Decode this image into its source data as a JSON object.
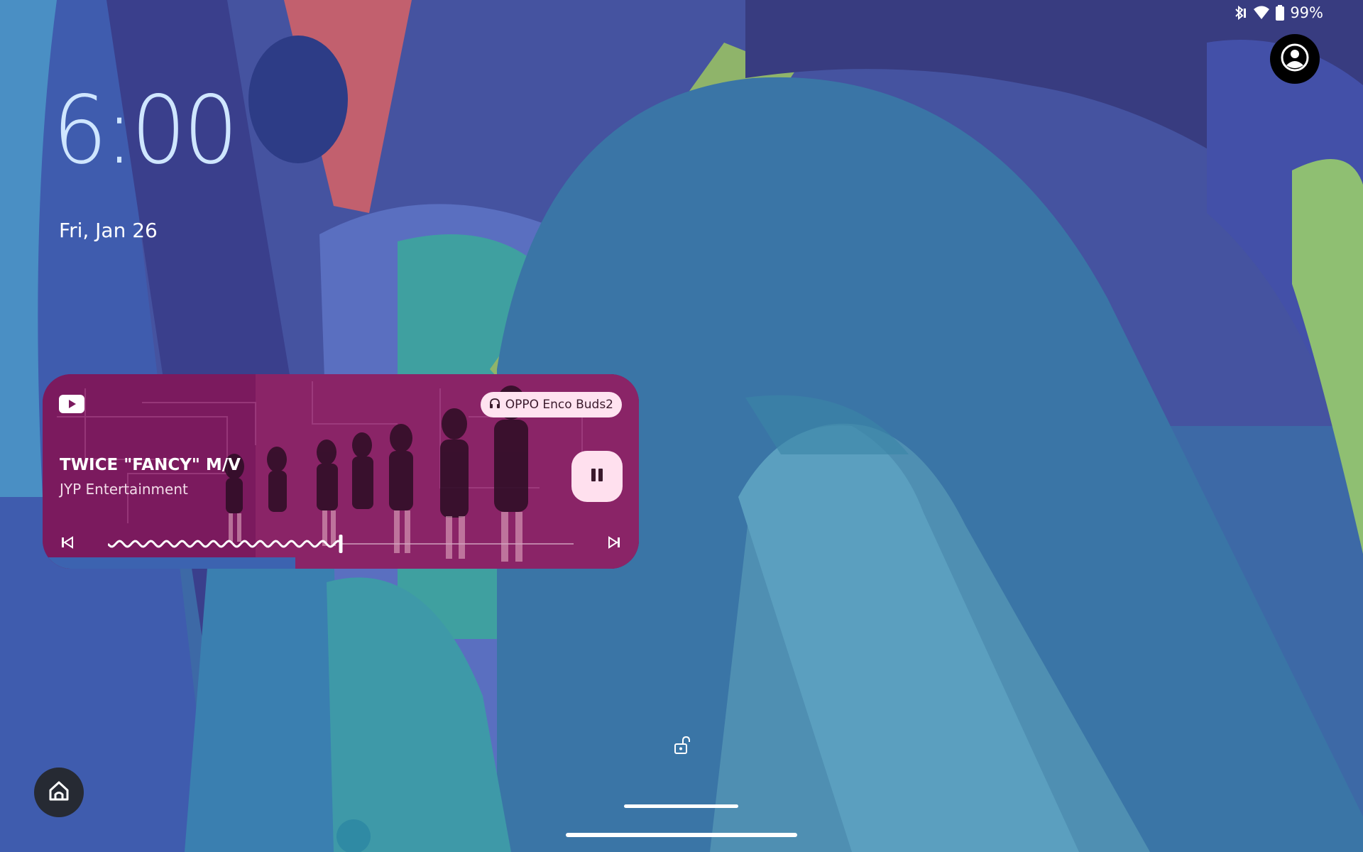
{
  "status_bar": {
    "battery_text": "99%",
    "icons": [
      "bluetooth-icon",
      "wifi-icon",
      "battery-icon"
    ]
  },
  "lockscreen": {
    "time": "6:00",
    "date": "Fri, Jan 26"
  },
  "media": {
    "app_icon": "youtube-icon",
    "output_device": "OPPO Enco Buds2",
    "title": "TWICE \"FANCY\" M/V",
    "artist": "JYP Entertainment",
    "progress_fraction": 0.5,
    "state": "playing"
  },
  "colors": {
    "clock": "#cfe6ff",
    "media_card": "#7b1a5e",
    "chip_background": "#ffe3f0",
    "pause_button": "#ffe0ee"
  }
}
